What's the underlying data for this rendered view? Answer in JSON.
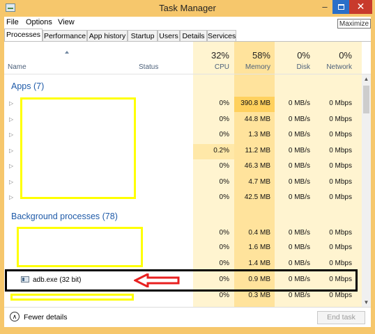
{
  "window": {
    "title": "Task Manager",
    "tooltip": "Maximize"
  },
  "menu": [
    "File",
    "Options",
    "View"
  ],
  "tabs": [
    "Processes",
    "Performance",
    "App history",
    "Startup",
    "Users",
    "Details",
    "Services"
  ],
  "header": {
    "name": "Name",
    "status": "Status",
    "cpu_pct": "32%",
    "cpu": "CPU",
    "mem_pct": "58%",
    "mem": "Memory",
    "disk_pct": "0%",
    "disk": "Disk",
    "net_pct": "0%",
    "net": "Network"
  },
  "sections": {
    "apps": "Apps (7)",
    "background": "Background processes (78)"
  },
  "apps": [
    {
      "cpu": "0%",
      "mem": "390.8 MB",
      "disk": "0 MB/s",
      "net": "0 Mbps"
    },
    {
      "cpu": "0%",
      "mem": "44.8 MB",
      "disk": "0 MB/s",
      "net": "0 Mbps"
    },
    {
      "cpu": "0%",
      "mem": "1.3 MB",
      "disk": "0 MB/s",
      "net": "0 Mbps"
    },
    {
      "cpu": "0.2%",
      "mem": "11.2 MB",
      "disk": "0 MB/s",
      "net": "0 Mbps"
    },
    {
      "cpu": "0%",
      "mem": "46.3 MB",
      "disk": "0 MB/s",
      "net": "0 Mbps"
    },
    {
      "cpu": "0%",
      "mem": "4.7 MB",
      "disk": "0 MB/s",
      "net": "0 Mbps"
    },
    {
      "cpu": "0%",
      "mem": "42.5 MB",
      "disk": "0 MB/s",
      "net": "0 Mbps"
    }
  ],
  "background": [
    {
      "name": "",
      "cpu": "0%",
      "mem": "0.4 MB",
      "disk": "0 MB/s",
      "net": "0 Mbps"
    },
    {
      "name": "",
      "cpu": "0%",
      "mem": "1.6 MB",
      "disk": "0 MB/s",
      "net": "0 Mbps"
    },
    {
      "name": "",
      "cpu": "0%",
      "mem": "1.4 MB",
      "disk": "0 MB/s",
      "net": "0 Mbps"
    },
    {
      "name": "adb.exe (32 bit)",
      "cpu": "0%",
      "mem": "0.9 MB",
      "disk": "0 MB/s",
      "net": "0 Mbps"
    },
    {
      "name": "",
      "cpu": "0%",
      "mem": "0.3 MB",
      "disk": "0 MB/s",
      "net": "0 Mbps"
    }
  ],
  "footer": {
    "fewer_details": "Fewer details",
    "end_task": "End task"
  },
  "colors": {
    "cpu_col": "#fff4d0",
    "mem_col": "#ffe39c",
    "mem_hot": "#ffd15e",
    "cpu_warm": "#ffe8a8",
    "annotation_yellow": "#ffff00",
    "annotation_red": "#e82020"
  }
}
